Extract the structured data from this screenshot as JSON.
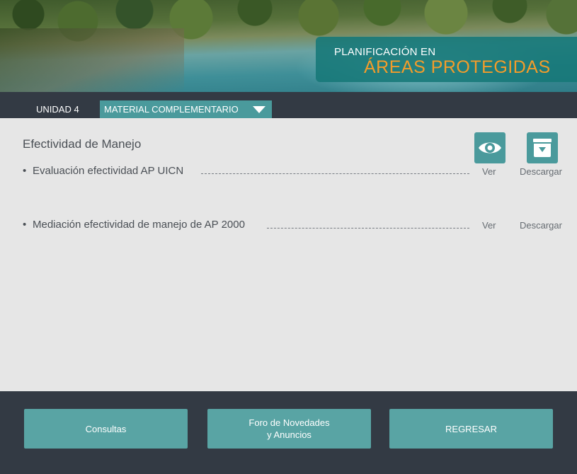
{
  "header": {
    "title_line1": "PLANIFICACIÓN EN",
    "title_line2": "ÁREAS PROTEGIDAS"
  },
  "nav": {
    "unit": "UNIDAD 4",
    "material_tab": "MATERIAL COMPLEMENTARIO",
    "material_tab_icon": "chevron-down-icon"
  },
  "section": {
    "title": "Efectividad de Manejo",
    "columns": {
      "view_icon": "eye-icon",
      "view_label": "Ver",
      "download_icon": "download-box-icon",
      "download_label": "Descargar"
    },
    "items": [
      {
        "bullet": "•",
        "label": "Evaluación efectividad AP UICN",
        "view": "Ver",
        "download": "Descargar"
      },
      {
        "bullet": "•",
        "label": "Mediación efectividad de manejo de AP 2000",
        "view": "Ver",
        "download": "Descargar"
      }
    ]
  },
  "footer": {
    "consultas": "Consultas",
    "foro_line1": "Foro de Novedades",
    "foro_line2": "y Anuncios",
    "regresar": "REGRESAR"
  },
  "colors": {
    "accent": "#4a9a9c",
    "dark": "#333a44",
    "title_highlight": "#f39c2a",
    "background": "#e6e6e6"
  }
}
